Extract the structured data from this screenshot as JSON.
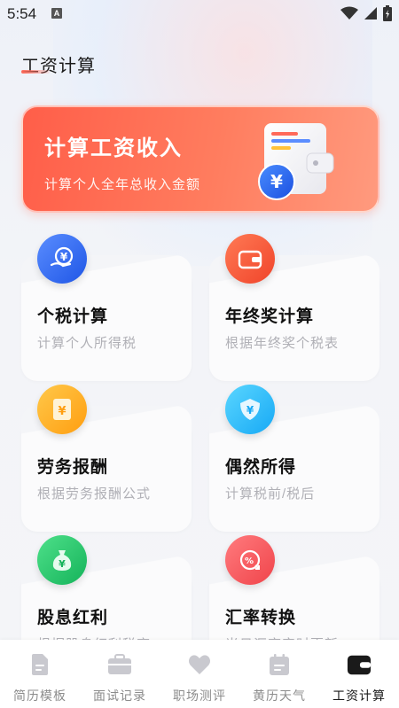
{
  "status_bar": {
    "time": "5:54",
    "a_badge": "A"
  },
  "page": {
    "title": "工资计算"
  },
  "banner": {
    "title": "计算工资收入",
    "subtitle": "计算个人全年总收入金额",
    "icon": "wallet-yen-icon",
    "colors": {
      "start": "#ff5e49",
      "end": "#ff9a7e"
    }
  },
  "cards": [
    {
      "title": "个税计算",
      "subtitle": "计算个人所得税",
      "icon": "yen-hand-icon",
      "color": "#2e6bff"
    },
    {
      "title": "年终奖计算",
      "subtitle": "根据年终奖个税表",
      "icon": "wallet-icon",
      "color": "#ff5a3c"
    },
    {
      "title": "劳务报酬",
      "subtitle": "根据劳务报酬公式",
      "icon": "yen-envelope-icon",
      "color": "#ffae1f"
    },
    {
      "title": "偶然所得",
      "subtitle": "计算税前/税后",
      "icon": "yen-shield-icon",
      "color": "#2cc0ff"
    },
    {
      "title": "股息红利",
      "subtitle": "根据股息红利税率",
      "icon": "yen-moneybag-icon",
      "color": "#1ec267"
    },
    {
      "title": "汇率转换",
      "subtitle": "当日汇率实时更新",
      "icon": "percent-exchange-icon",
      "color": "#ff5a5f"
    }
  ],
  "tabs": [
    {
      "label": "简历模板",
      "icon": "resume-icon",
      "active": false
    },
    {
      "label": "面试记录",
      "icon": "briefcase-icon",
      "active": false
    },
    {
      "label": "职场测评",
      "icon": "heart-icon",
      "active": false
    },
    {
      "label": "黄历天气",
      "icon": "calendar-icon",
      "active": false
    },
    {
      "label": "工资计算",
      "icon": "wallet-icon",
      "active": true
    }
  ]
}
